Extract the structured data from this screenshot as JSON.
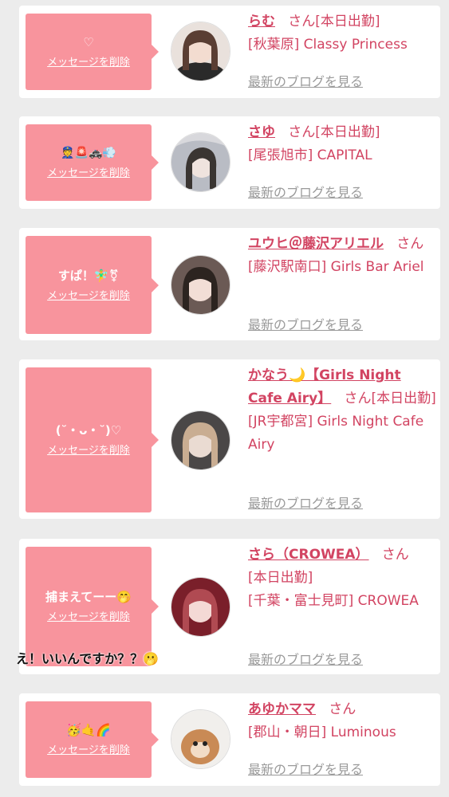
{
  "colors": {
    "accent": "#d24462",
    "bubble": "#f8949d",
    "link_gray": "#9a9a9a"
  },
  "delete_label": "メッセージを削除",
  "blog_label": "最新のブログを見る",
  "cards": [
    {
      "message": "♡",
      "name": "らむ",
      "san": "さん",
      "status": "[本日出勤]",
      "shop": "[秋葉原] Classy Princess"
    },
    {
      "message": "👮🚨🚓💨",
      "name": "さゆ",
      "san": "さん",
      "status": "[本日出勤]",
      "shop": "[尾張旭市] CAPITAL"
    },
    {
      "message": "すぱ！🧚‍♂️⚧",
      "name": "ユウヒ＠藤沢アリエル",
      "san": "さん",
      "status": "",
      "shop": "[藤沢駅南口] Girls Bar Ariel"
    },
    {
      "message": "(˘・ᴗ・˘)♡",
      "name": "かなう🌙【Girls Night Cafe Airy】",
      "san": "さん",
      "status": "[本日出勤]",
      "shop": "[JR宇都宮] Girls Night Cafe Airy"
    },
    {
      "message": "捕まえてーー🤭",
      "name": "さら（CROWEA）",
      "san": "さん",
      "status": "[本日出勤]",
      "shop": "[千葉・富士見町] CROWEA"
    },
    {
      "message": "🥳🤙🌈",
      "name": "あゆかママ",
      "san": "さん",
      "status": "",
      "shop": "[郡山・朝日] Luminous"
    }
  ],
  "overlay": "え！いいんですか？？🫢"
}
